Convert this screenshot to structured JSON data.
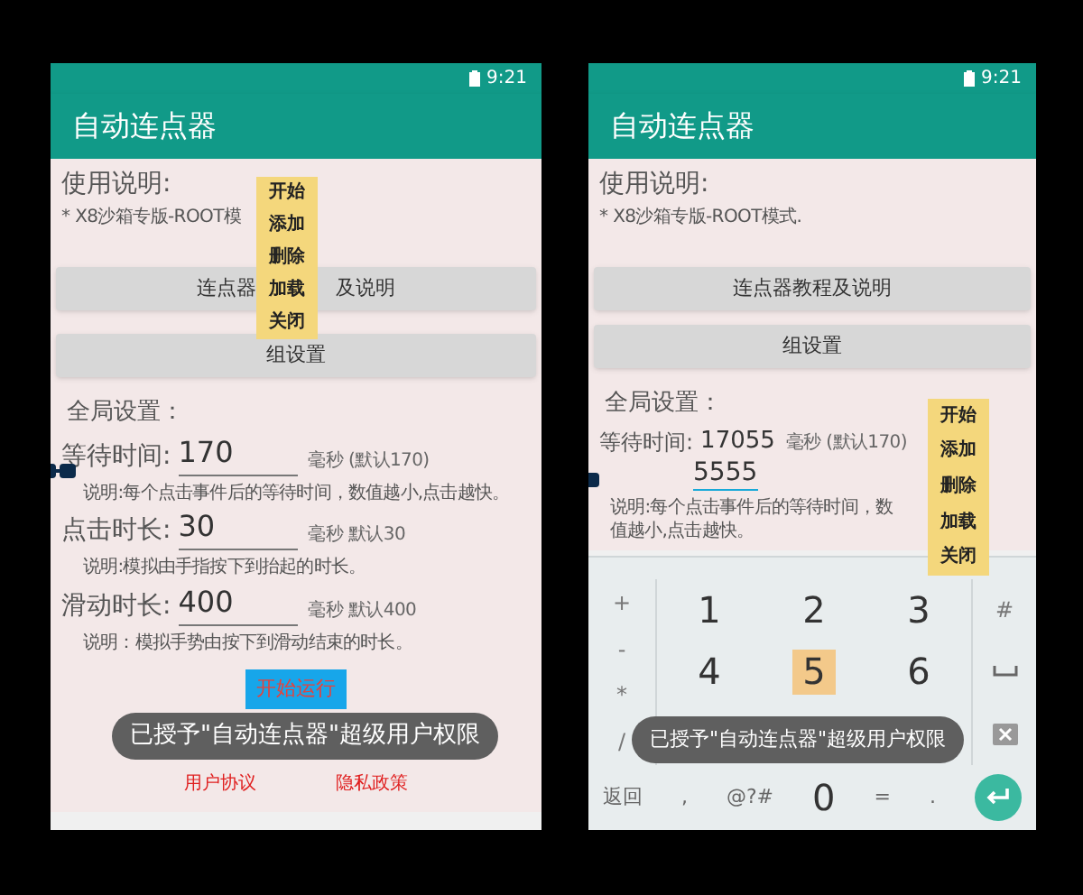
{
  "phones": [
    {
      "time": "9:21",
      "app_title": "自动连点器",
      "usage_title": "使用说明:",
      "usage_text": "* X8沙箱专版-ROOT模",
      "buttons": [
        {
          "label_parts": [
            "连点器",
            "及说明"
          ]
        },
        {
          "label_parts": [
            "组设置"
          ]
        }
      ],
      "global_title": "全局设置：",
      "settings": [
        {
          "label": "等待时间:",
          "value": "170",
          "unit": "毫秒 (默认170)",
          "note": "说明:每个点击事件后的等待时间，数值越小,点击越快。",
          "focused": false
        },
        {
          "label": "点击时长:",
          "value": "30",
          "unit": "毫秒 默认30",
          "note": "说明:模拟由手指按下到抬起的时长。",
          "focused": false
        },
        {
          "label": "滑动时长:",
          "value": "400",
          "unit": "毫秒 默认400",
          "note": "说明：模拟手势由按下到滑动结束的时长。",
          "focused": false
        }
      ],
      "run_button": "开始运行",
      "links": [
        "用户协议",
        "隐私政策"
      ],
      "toast": "已授予\"自动连点器\"超级用户权限",
      "float_menu": [
        "开始",
        "添加",
        "删除",
        "加载",
        "关闭"
      ]
    },
    {
      "time": "9:21",
      "app_title": "自动连点器",
      "usage_title": "使用说明:",
      "usage_text": "* X8沙箱专版-ROOT模式.",
      "buttons": [
        {
          "label_parts": [
            "连点器教程及说明"
          ]
        },
        {
          "label_parts": [
            "组设置"
          ]
        }
      ],
      "global_title": "全局设置：",
      "settings": [
        {
          "label": "等待时间:",
          "previous_value": "17055",
          "value": "5555",
          "unit": "毫秒 (默认170)",
          "note": "说明:每个点击事件后的等待时间，数值越小,点击越快。",
          "focused": true
        }
      ],
      "toast": "已授予\"自动连点器\"超级用户权限",
      "float_menu": [
        "开始",
        "添加",
        "删除",
        "加载",
        "关闭"
      ],
      "keypad": {
        "left_keys": [
          "+",
          "-",
          "*",
          "/"
        ],
        "digit_rows": [
          [
            {
              "label": "1",
              "pressed": false
            },
            {
              "label": "2",
              "pressed": false
            },
            {
              "label": "3",
              "pressed": false
            }
          ],
          [
            {
              "label": "4",
              "pressed": false
            },
            {
              "label": "5",
              "pressed": true
            },
            {
              "label": "6",
              "pressed": false
            }
          ]
        ],
        "right_keys": [
          {
            "kind": "text",
            "label": "#"
          },
          {
            "kind": "space"
          },
          {
            "kind": "backspace"
          }
        ],
        "bottom_keys": [
          {
            "kind": "text",
            "label": "返回"
          },
          {
            "kind": "text",
            "label": ","
          },
          {
            "kind": "text",
            "label": "@?#"
          },
          {
            "kind": "digit",
            "label": "0"
          },
          {
            "kind": "text",
            "label": "="
          },
          {
            "kind": "text",
            "label": "."
          },
          {
            "kind": "enter"
          }
        ]
      }
    }
  ]
}
